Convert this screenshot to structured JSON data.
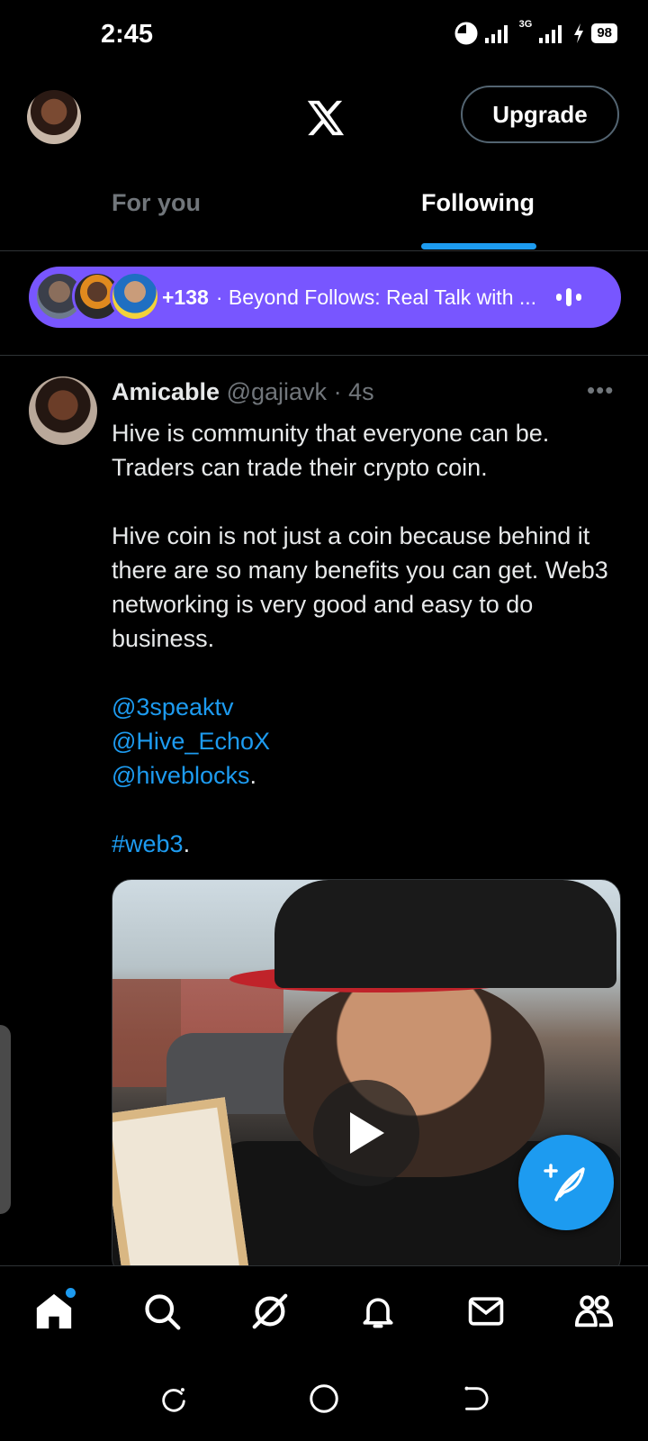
{
  "status_bar": {
    "time": "2:45",
    "network": "3G",
    "battery": "98"
  },
  "header": {
    "upgrade_label": "Upgrade"
  },
  "tabs": [
    {
      "label": "For you",
      "active": false
    },
    {
      "label": "Following",
      "active": true
    }
  ],
  "spaces_pill": {
    "count": "+138",
    "separator": "·",
    "title": "Beyond Follows: Real Talk with ..."
  },
  "tweet": {
    "name": "Amicable",
    "handle": "@gajiavk",
    "separator": "·",
    "time": "4s",
    "more": "•••",
    "lines": [
      "Hive is community that everyone can be.",
      "Traders can trade their crypto coin.",
      "Hive coin is not just a coin because behind it there are so many benefits you can get. Web3 networking is very good and easy to do business."
    ],
    "mentions": [
      "@3speaktv",
      "@Hive_EchoX",
      "@hiveblocks"
    ],
    "mentions_trailing": ".",
    "hashtag": "#web3",
    "hashtag_trailing": "."
  },
  "bottom_nav": {
    "items": [
      "home-icon",
      "search-icon",
      "grok-icon",
      "notifications-icon",
      "messages-icon",
      "communities-icon"
    ]
  },
  "colors": {
    "accent": "#1d9bf0",
    "spaces": "#7856ff",
    "muted": "#71767b",
    "background": "#000000"
  }
}
